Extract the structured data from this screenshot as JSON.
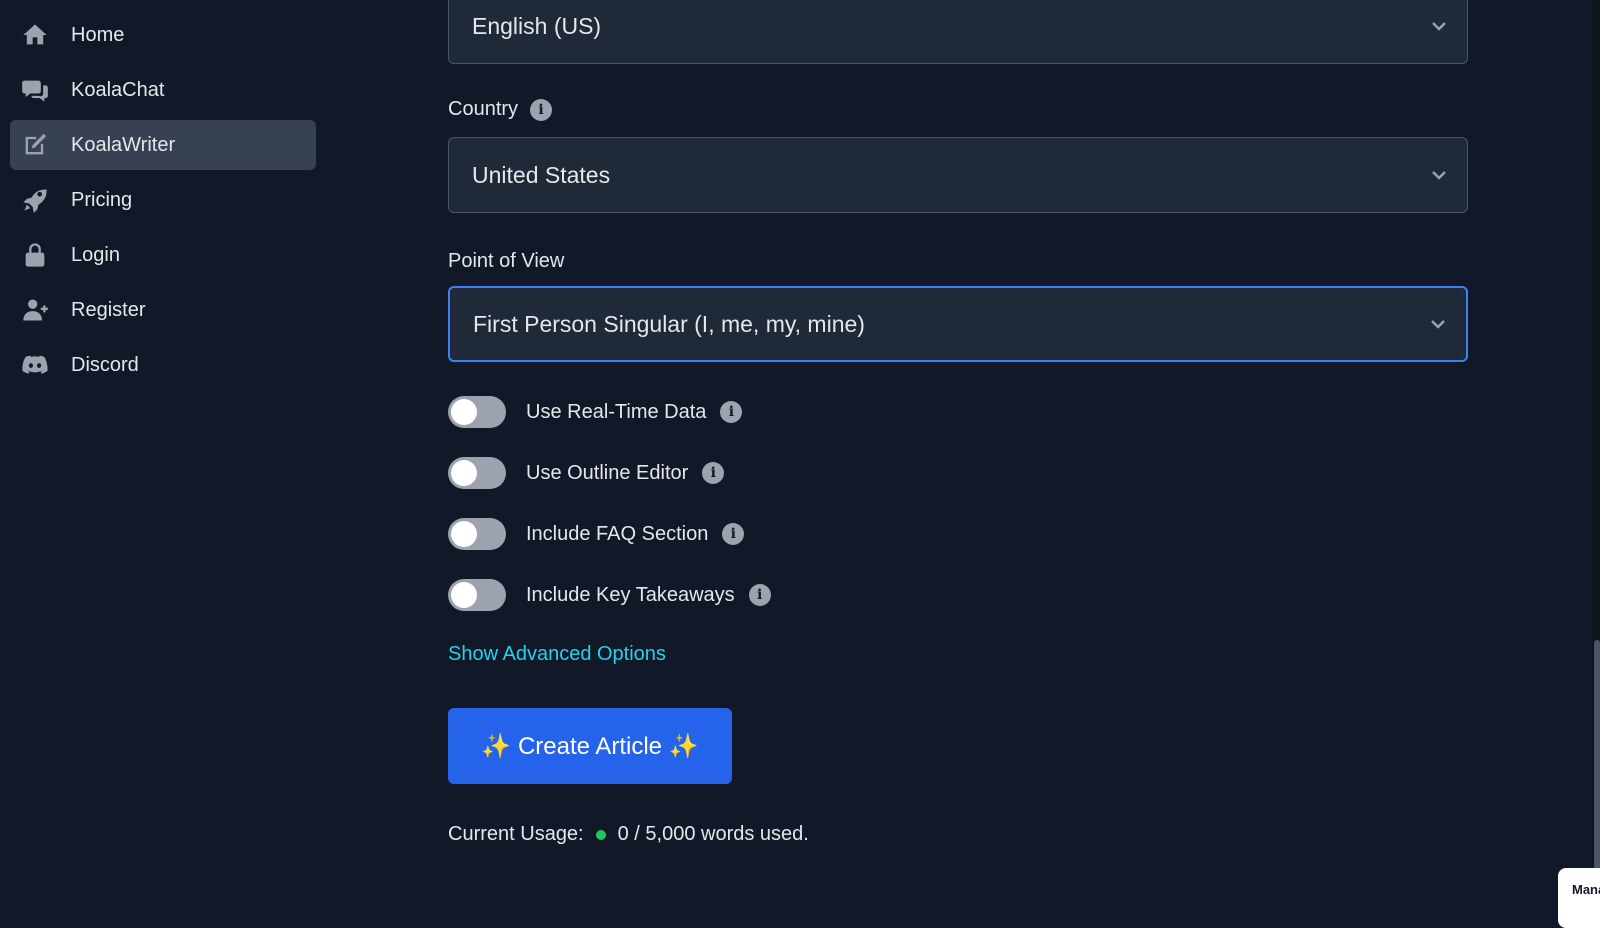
{
  "sidebar": {
    "items": [
      {
        "label": "Home",
        "icon": "home-icon",
        "active": false
      },
      {
        "label": "KoalaChat",
        "icon": "chat-icon",
        "active": false
      },
      {
        "label": "KoalaWriter",
        "icon": "edit-icon",
        "active": true
      },
      {
        "label": "Pricing",
        "icon": "rocket-icon",
        "active": false
      },
      {
        "label": "Login",
        "icon": "lock-icon",
        "active": false
      },
      {
        "label": "Register",
        "icon": "user-plus-icon",
        "active": false
      },
      {
        "label": "Discord",
        "icon": "discord-icon",
        "active": false
      }
    ]
  },
  "form": {
    "language": {
      "value": "English (US)"
    },
    "country": {
      "label": "Country",
      "value": "United States"
    },
    "point_of_view": {
      "label": "Point of View",
      "value": "First Person Singular (I, me, my, mine)"
    },
    "toggles": [
      {
        "label": "Use Real-Time Data",
        "on": false
      },
      {
        "label": "Use Outline Editor",
        "on": false
      },
      {
        "label": "Include FAQ Section",
        "on": false
      },
      {
        "label": "Include Key Takeaways",
        "on": false
      }
    ],
    "advanced_link": "Show Advanced Options",
    "create_button": "✨ Create Article ✨",
    "usage": {
      "label": "Current Usage:",
      "text": "0 / 5,000 words used."
    }
  },
  "popup": {
    "text": "Mana"
  },
  "colors": {
    "background": "#111827",
    "accent": "#2563eb",
    "link": "#22d3ee",
    "status_ok": "#22c55e"
  }
}
